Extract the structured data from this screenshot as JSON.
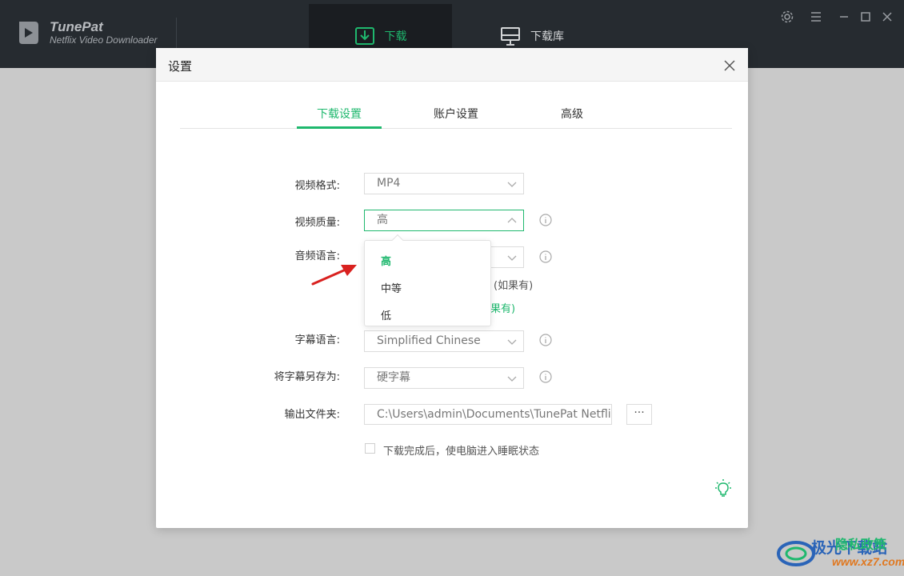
{
  "app": {
    "brand_name": "TunePat",
    "brand_sub": "Netflix Video Downloader"
  },
  "nav": {
    "download_label": "下载",
    "library_label": "下载库"
  },
  "dialog": {
    "title": "设置",
    "tabs": [
      {
        "label": "下载设置",
        "active": true
      },
      {
        "label": "账户设置",
        "active": false
      },
      {
        "label": "高级",
        "active": false
      }
    ],
    "fields": {
      "video_format": {
        "label": "视频格式:",
        "value": "MP4"
      },
      "video_quality": {
        "label": "视频质量:",
        "value": "高"
      },
      "audio_language": {
        "label": "音频语言:"
      },
      "audio_partial_1": "(如果有)",
      "audio_partial_2": "果有)",
      "subtitle_language": {
        "label": "字幕语言:",
        "value": "Simplified Chinese"
      },
      "save_subtitle_as": {
        "label": "将字幕另存为:",
        "value": "硬字幕"
      },
      "output_folder": {
        "label": "输出文件夹:",
        "value": "C:\\Users\\admin\\Documents\\TunePat Netflix V"
      },
      "browse_label": "···",
      "sleep_after": {
        "label": "下载完成后，使电脑进入睡眠状态",
        "checked": false
      }
    },
    "quality_options": [
      {
        "label": "高",
        "selected": true
      },
      {
        "label": "中等",
        "selected": false
      },
      {
        "label": "低",
        "selected": false
      }
    ]
  },
  "watermark": {
    "text_cn": "极光下载站",
    "text_overlay": "隐私政策",
    "url": "www.xz7.com"
  },
  "colors": {
    "accent": "#1fb86e",
    "titlebar": "#262b30",
    "annotation_arrow": "#d9211f"
  }
}
